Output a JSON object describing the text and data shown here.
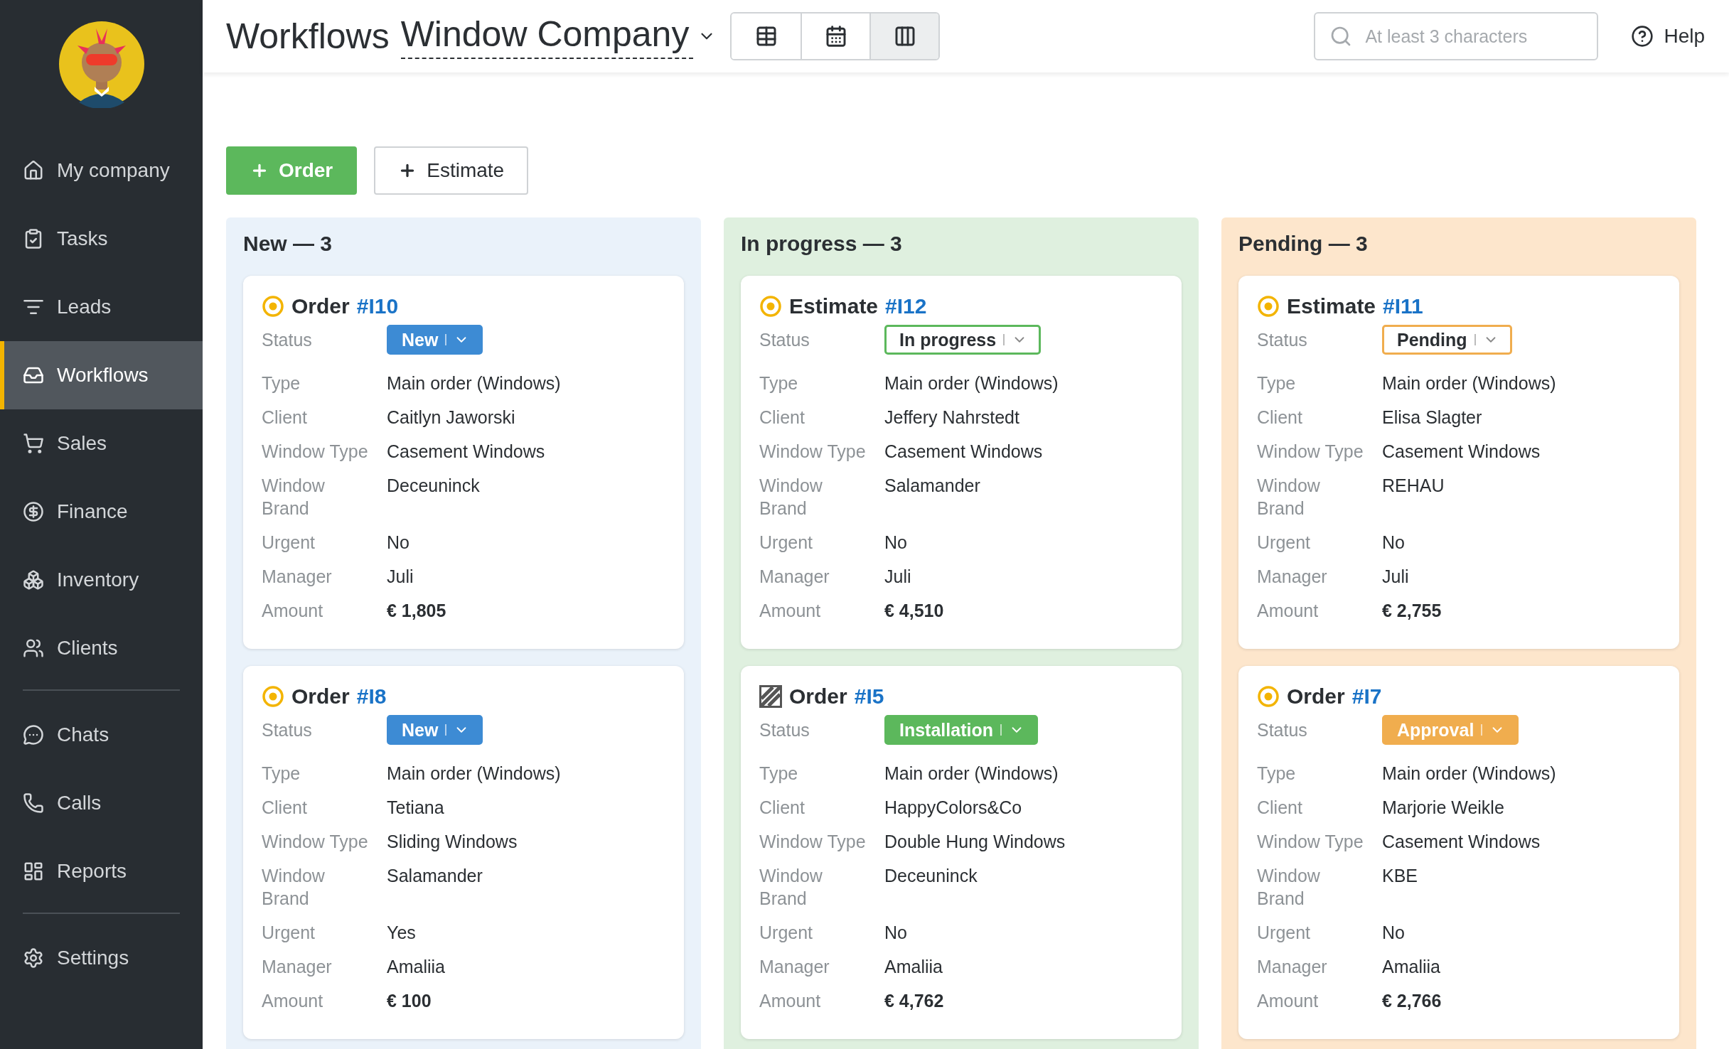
{
  "sidebar": {
    "sections": [
      {
        "items": [
          {
            "label": "My company",
            "selected": false
          },
          {
            "label": "Tasks",
            "selected": false
          },
          {
            "label": "Leads",
            "selected": false
          },
          {
            "label": "Workflows",
            "selected": true
          },
          {
            "label": "Sales",
            "selected": false
          },
          {
            "label": "Finance",
            "selected": false
          },
          {
            "label": "Inventory",
            "selected": false
          },
          {
            "label": "Clients",
            "selected": false
          }
        ]
      },
      {
        "items": [
          {
            "label": "Chats",
            "selected": false
          },
          {
            "label": "Calls",
            "selected": false
          },
          {
            "label": "Reports",
            "selected": false
          }
        ]
      },
      {
        "items": [
          {
            "label": "Settings",
            "selected": false
          }
        ]
      }
    ]
  },
  "header": {
    "title": "Workflows",
    "company": "Window Company",
    "views": [
      {
        "selected": false
      },
      {
        "selected": false
      },
      {
        "selected": true
      }
    ],
    "search": {
      "placeholder": "At least 3 characters"
    },
    "help": "Help"
  },
  "actions": [
    {
      "label": "Order",
      "kind": "primary"
    },
    {
      "label": "Estimate",
      "kind": "secondary"
    }
  ],
  "columns": [
    {
      "title": "New — 3",
      "color": "#eaf2fa",
      "cards": [
        {
          "kind": "target",
          "type": "Order",
          "number": "#I10",
          "fields": [
            {
              "kind": "pill",
              "label": "Status",
              "value": "New",
              "color": "#3d8bd4"
            },
            {
              "kind": "text",
              "label": "Type",
              "value": "Main order (Windows)"
            },
            {
              "kind": "text",
              "label": "Client",
              "value": "Caitlyn Jaworski"
            },
            {
              "kind": "text",
              "label": "Window Type",
              "value": "Casement Windows"
            },
            {
              "kind": "text",
              "label": "Window Brand",
              "value": "Deceuninck"
            },
            {
              "kind": "text",
              "label": "Urgent",
              "value": "No"
            },
            {
              "kind": "text",
              "label": "Manager",
              "value": "Juli"
            },
            {
              "kind": "amount",
              "label": "Amount",
              "value": "€ 1,805"
            }
          ]
        },
        {
          "kind": "target",
          "type": "Order",
          "number": "#I8",
          "fields": [
            {
              "kind": "pill",
              "label": "Status",
              "value": "New",
              "color": "#3d8bd4"
            },
            {
              "kind": "text",
              "label": "Type",
              "value": "Main order (Windows)"
            },
            {
              "kind": "text",
              "label": "Client",
              "value": "Tetiana"
            },
            {
              "kind": "text",
              "label": "Window Type",
              "value": "Sliding Windows"
            },
            {
              "kind": "text",
              "label": "Window Brand",
              "value": "Salamander"
            },
            {
              "kind": "text",
              "label": "Urgent",
              "value": "Yes"
            },
            {
              "kind": "text",
              "label": "Manager",
              "value": "Amaliia"
            },
            {
              "kind": "amount",
              "label": "Amount",
              "value": "€ 100"
            }
          ]
        }
      ]
    },
    {
      "title": "In progress — 3",
      "color": "#dff0df",
      "cards": [
        {
          "kind": "target",
          "type": "Estimate",
          "number": "#I12",
          "fields": [
            {
              "kind": "outline",
              "label": "Status",
              "value": "In progress",
              "color": "#5cb85c"
            },
            {
              "kind": "text",
              "label": "Type",
              "value": "Main order (Windows)"
            },
            {
              "kind": "text",
              "label": "Client",
              "value": "Jeffery Nahrstedt"
            },
            {
              "kind": "text",
              "label": "Window Type",
              "value": "Casement Windows"
            },
            {
              "kind": "text",
              "label": "Window Brand",
              "value": "Salamander"
            },
            {
              "kind": "text",
              "label": "Urgent",
              "value": "No"
            },
            {
              "kind": "text",
              "label": "Manager",
              "value": "Juli"
            },
            {
              "kind": "amount",
              "label": "Amount",
              "value": "€ 4,510"
            }
          ]
        },
        {
          "kind": "hatched",
          "type": "Order",
          "number": "#I5",
          "fields": [
            {
              "kind": "pill",
              "label": "Status",
              "value": "Installation",
              "color": "#5cb85c"
            },
            {
              "kind": "text",
              "label": "Type",
              "value": "Main order (Windows)"
            },
            {
              "kind": "text",
              "label": "Client",
              "value": "HappyColors&Co"
            },
            {
              "kind": "text",
              "label": "Window Type",
              "value": "Double Hung Windows"
            },
            {
              "kind": "text",
              "label": "Window Brand",
              "value": "Deceuninck"
            },
            {
              "kind": "text",
              "label": "Urgent",
              "value": "No"
            },
            {
              "kind": "text",
              "label": "Manager",
              "value": "Amaliia"
            },
            {
              "kind": "amount",
              "label": "Amount",
              "value": "€ 4,762"
            }
          ]
        }
      ]
    },
    {
      "title": "Pending — 3",
      "color": "#fde6cc",
      "cards": [
        {
          "kind": "target",
          "type": "Estimate",
          "number": "#I11",
          "fields": [
            {
              "kind": "outline",
              "label": "Status",
              "value": "Pending",
              "color": "#f0ad4e"
            },
            {
              "kind": "text",
              "label": "Type",
              "value": "Main order (Windows)"
            },
            {
              "kind": "text",
              "label": "Client",
              "value": "Elisa Slagter"
            },
            {
              "kind": "text",
              "label": "Window Type",
              "value": "Casement Windows"
            },
            {
              "kind": "text",
              "label": "Window Brand",
              "value": "REHAU"
            },
            {
              "kind": "text",
              "label": "Urgent",
              "value": "No"
            },
            {
              "kind": "text",
              "label": "Manager",
              "value": "Juli"
            },
            {
              "kind": "amount",
              "label": "Amount",
              "value": "€ 2,755"
            }
          ]
        },
        {
          "kind": "target",
          "type": "Order",
          "number": "#I7",
          "fields": [
            {
              "kind": "pill",
              "label": "Status",
              "value": "Approval",
              "color": "#f0ad4e"
            },
            {
              "kind": "text",
              "label": "Type",
              "value": "Main order (Windows)"
            },
            {
              "kind": "text",
              "label": "Client",
              "value": "Marjorie Weikle"
            },
            {
              "kind": "text",
              "label": "Window Type",
              "value": "Casement Windows"
            },
            {
              "kind": "text",
              "label": "Window Brand",
              "value": "KBE"
            },
            {
              "kind": "text",
              "label": "Urgent",
              "value": "No"
            },
            {
              "kind": "text",
              "label": "Manager",
              "value": "Amaliia"
            },
            {
              "kind": "amount",
              "label": "Amount",
              "value": "€ 2,766"
            }
          ]
        }
      ]
    }
  ]
}
